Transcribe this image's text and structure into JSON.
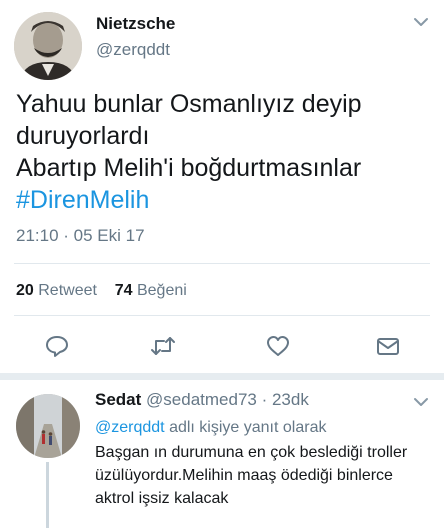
{
  "tweet": {
    "author_name": "Nietzsche",
    "author_handle": "@zerqddt",
    "text_lines": [
      "Yahuu bunlar Osmanlıyız deyip",
      "duruyorlardı",
      "Abartıp Melih'i boğdurtmasınlar"
    ],
    "hashtag": "#DirenMelih",
    "timestamp": "21:10 · 05 Eki 17",
    "retweet_count": "20",
    "retweet_label": "Retweet",
    "like_count": "74",
    "like_label": "Beğeni"
  },
  "actions": [
    "reply-icon",
    "retweet-icon",
    "like-icon",
    "message-icon"
  ],
  "reply": {
    "author_name": "Sedat",
    "author_handle": "@sedatmed73",
    "age": "23dk",
    "replying_to_handle": "@zerqddt",
    "replying_to_suffix": "adlı kişiye yanıt olarak",
    "text": "Başgan ın durumuna en çok beslediği troller üzülüyordur.Melihin maaş ödediği binlerce aktrol işsiz kalacak"
  },
  "colors": {
    "accent": "#1b95e0",
    "secondary_text": "#657786",
    "divider": "#e1e8ed",
    "icon": "#657786"
  }
}
